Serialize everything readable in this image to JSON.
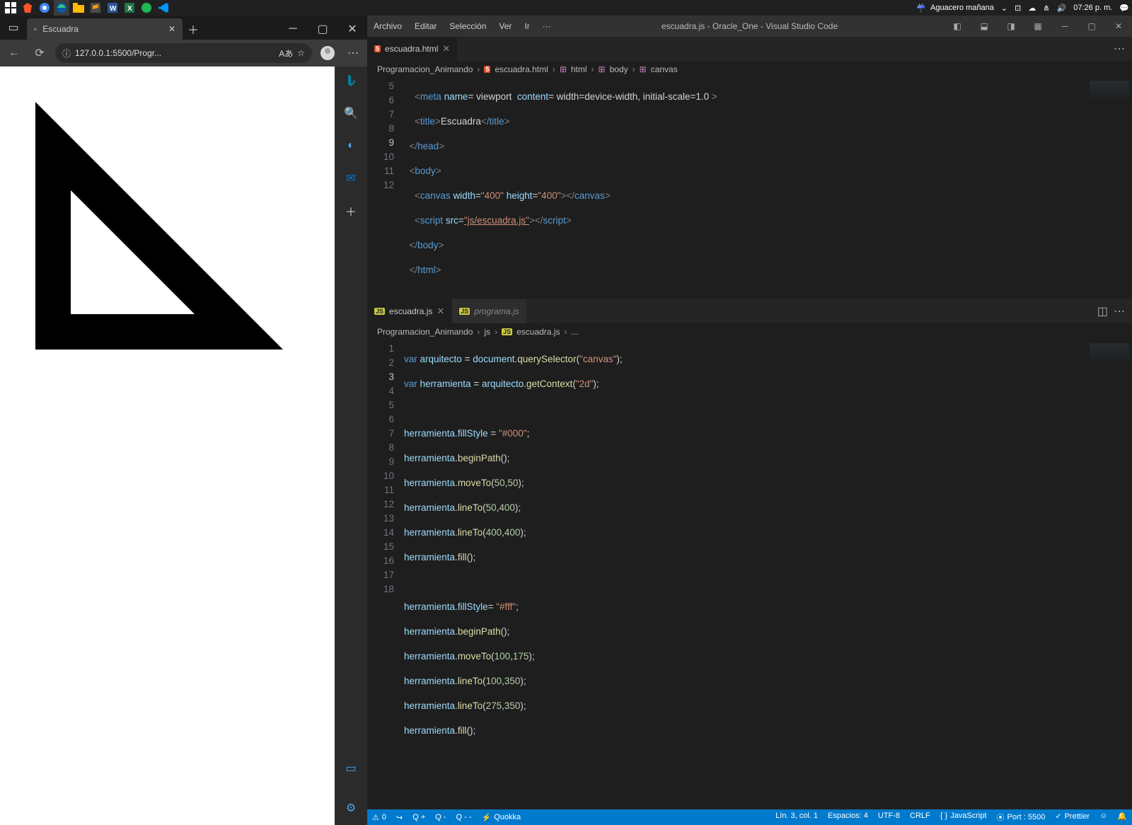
{
  "taskbar": {
    "weather": "Aguacero mañana",
    "time": "07:26 p. m."
  },
  "browser": {
    "tab_title": "Escuadra",
    "url": "127.0.0.1:5500/Progr..."
  },
  "vscode": {
    "menu": {
      "archivo": "Archivo",
      "editar": "Editar",
      "seleccion": "Selección",
      "ver": "Ver",
      "ir": "Ir",
      "mas": "···"
    },
    "title": "escuadra.js - Oracle_One - Visual Studio Code",
    "groupA": {
      "tab1": "escuadra.html",
      "breadcrumbs": {
        "a": "Programacion_Animando",
        "b": "escuadra.html",
        "c": "html",
        "d": "body",
        "e": "canvas"
      },
      "lines": {
        "l5a": "<",
        "l5b": "meta ",
        "l5c": "name",
        "l5d": "= viewport  ",
        "l5e": "content",
        "l5f": "= width=device-width, initial-scale=1.0 ",
        "l5g": ">",
        "l6a": "<",
        "l6b": "title",
        "l6c": ">",
        "l6d": "Escuadra",
        "l6e": "</",
        "l6f": "title",
        "l6g": ">",
        "l7a": "</",
        "l7b": "head",
        "l7c": ">",
        "l8a": "<",
        "l8b": "body",
        "l8c": ">",
        "l9a": "<",
        "l9b": "canvas ",
        "l9c": "width",
        "l9d": "=",
        "l9e": "\"400\"",
        "l9f": " height",
        "l9g": "=",
        "l9h": "\"400\"",
        "l9i": "></",
        "l9j": "canvas",
        "l9k": ">",
        "l10a": "<",
        "l10b": "script ",
        "l10c": "src",
        "l10d": "=",
        "l10e": "\"js/escuadra.js\"",
        "l10f": "></",
        "l10g": "script",
        "l10h": ">",
        "l11a": "</",
        "l11b": "body",
        "l11c": ">",
        "l12a": "</",
        "l12b": "html",
        "l12c": ">"
      },
      "gutter": [
        "5",
        "6",
        "7",
        "8",
        "9",
        "10",
        "11",
        "12"
      ]
    },
    "groupB": {
      "tab1": "escuadra.js",
      "tab2": "programa.js",
      "breadcrumbs": {
        "a": "Programacion_Animando",
        "b": "js",
        "c": "escuadra.js",
        "d": "..."
      },
      "gutter": [
        "1",
        "2",
        "3",
        "4",
        "5",
        "6",
        "7",
        "8",
        "9",
        "10",
        "11",
        "12",
        "13",
        "14",
        "15",
        "16",
        "17",
        "18"
      ],
      "lines": {
        "l1": {
          "a": "var ",
          "b": "arquitecto ",
          "c": "= ",
          "d": "document",
          "e": ".",
          "f": "querySelector",
          "g": "(",
          "h": "\"canvas\"",
          "i": ");"
        },
        "l2": {
          "a": "var ",
          "b": "herramienta ",
          "c": "= ",
          "d": "arquitecto",
          "e": ".",
          "f": "getContext",
          "g": "(",
          "h": "\"2d\"",
          "i": ");"
        },
        "l4": {
          "a": "herramienta",
          "b": ".",
          "c": "fillStyle ",
          "d": "= ",
          "e": "\"#000\"",
          "f": ";"
        },
        "l5": {
          "a": "herramienta",
          "b": ".",
          "c": "beginPath",
          "d": "();"
        },
        "l6": {
          "a": "herramienta",
          "b": ".",
          "c": "moveTo",
          "d": "(",
          "e": "50",
          "f": ",",
          "g": "50",
          "h": ");"
        },
        "l7": {
          "a": "herramienta",
          "b": ".",
          "c": "lineTo",
          "d": "(",
          "e": "50",
          "f": ",",
          "g": "400",
          "h": ");"
        },
        "l8": {
          "a": "herramienta",
          "b": ".",
          "c": "lineTo",
          "d": "(",
          "e": "400",
          "f": ",",
          "g": "400",
          "h": ");"
        },
        "l9": {
          "a": "herramienta",
          "b": ".",
          "c": "fill",
          "d": "();"
        },
        "l11": {
          "a": "herramienta",
          "b": ".",
          "c": "fillStyle",
          "d": "= ",
          "e": "\"#fff\"",
          "f": ";"
        },
        "l12": {
          "a": "herramienta",
          "b": ".",
          "c": "beginPath",
          "d": "();"
        },
        "l13": {
          "a": "herramienta",
          "b": ".",
          "c": "moveTo",
          "d": "(",
          "e": "100",
          "f": ",",
          "g": "175",
          "h": ");"
        },
        "l14": {
          "a": "herramienta",
          "b": ".",
          "c": "lineTo",
          "d": "(",
          "e": "100",
          "f": ",",
          "g": "350",
          "h": ");"
        },
        "l15": {
          "a": "herramienta",
          "b": ".",
          "c": "lineTo",
          "d": "(",
          "e": "275",
          "f": ",",
          "g": "350",
          "h": ");"
        },
        "l16": {
          "a": "herramienta",
          "b": ".",
          "c": "fill",
          "d": "();"
        }
      }
    },
    "status": {
      "warn": "0",
      "quokka": "Quokka",
      "pos": "Lín. 3, col. 1",
      "spaces": "Espacios: 4",
      "enc": "UTF-8",
      "eol": "CRLF",
      "lang": "JavaScript",
      "port": "Port : 5500",
      "prettier": "Prettier",
      "qplus": "Q +",
      "qminus": "Q -",
      "qmm": "Q - -"
    }
  }
}
